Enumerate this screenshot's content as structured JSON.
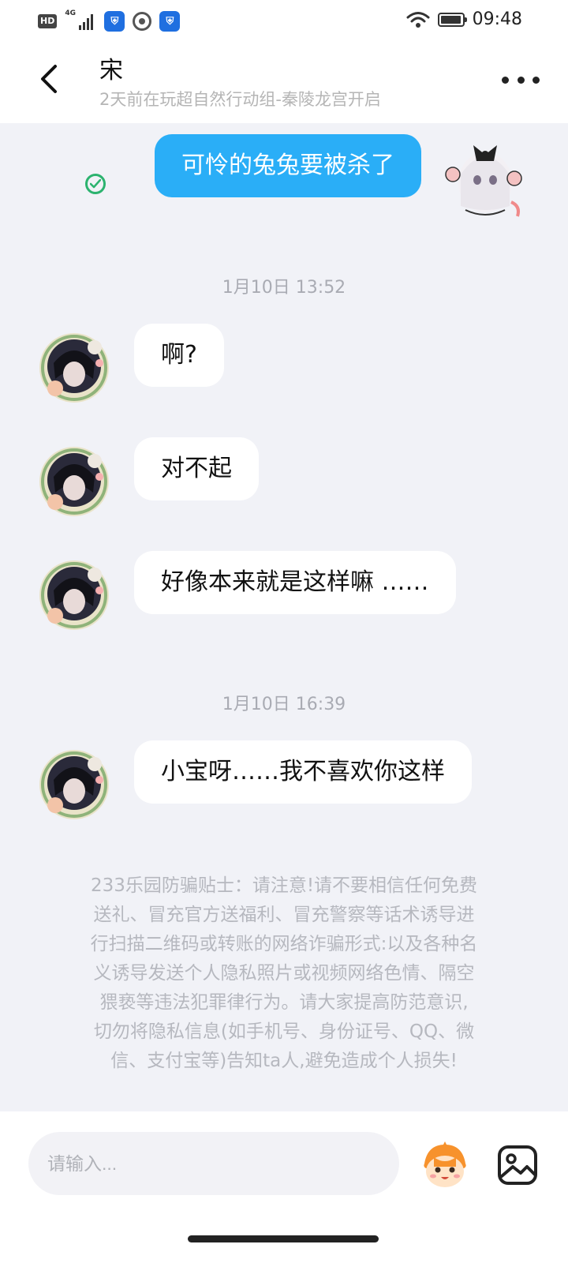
{
  "status_bar": {
    "hd": "HD",
    "network": "4G",
    "time": "09:48",
    "app_icon_glyph": "⛨",
    "icons": [
      "hd-icon",
      "signal-icon",
      "shield-app-icon",
      "record-icon",
      "shield-app-icon",
      "wifi-icon",
      "battery-icon"
    ]
  },
  "header": {
    "title": "宋",
    "subtitle": "2天前在玩超自然行动组-秦陵龙宫开启",
    "back_icon": "back-arrow-icon",
    "more_icon": "more-icon"
  },
  "messages": [
    {
      "side": "out",
      "text": "可怜的兔兔要被杀了",
      "status": "sent"
    },
    {
      "timestamp": "1月10日 13:52"
    },
    {
      "side": "in",
      "text": "啊?"
    },
    {
      "side": "in",
      "text": "对不起"
    },
    {
      "side": "in",
      "text": "好像本来就是这样嘛 ……"
    },
    {
      "timestamp": "1月10日 16:39"
    },
    {
      "side": "in",
      "text": "小宝呀……我不喜欢你这样"
    }
  ],
  "chat": {
    "m1": "可怜的兔兔要被杀了",
    "ts1": "1月10日 13:52",
    "m2": "啊?",
    "m3": "对不起",
    "m4": "好像本来就是这样嘛 ……",
    "ts2": "1月10日 16:39",
    "m5": "小宝呀……我不喜欢你这样"
  },
  "tips": [
    "233乐园防骗贴士：请注意!请不要相信任何免费",
    "送礼、冒充官方送福利、冒充警察等话术诱导进",
    "行扫描二维码或转账的网络诈骗形式:以及各种名",
    "义诱导发送个人隐私照片或视频网络色情、隔空",
    "猥亵等违法犯罪律行为。请大家提高防范意识,",
    "切勿将隐私信息(如手机号、身份证号、QQ、微",
    "信、支付宝等)告知ta人,避免造成个人损失!"
  ],
  "input": {
    "placeholder": "请输入...",
    "value": ""
  },
  "colors": {
    "outgoing_bubble": "#2aaef7",
    "chat_background": "#f1f2f7",
    "sent_check": "#2cb36f"
  }
}
